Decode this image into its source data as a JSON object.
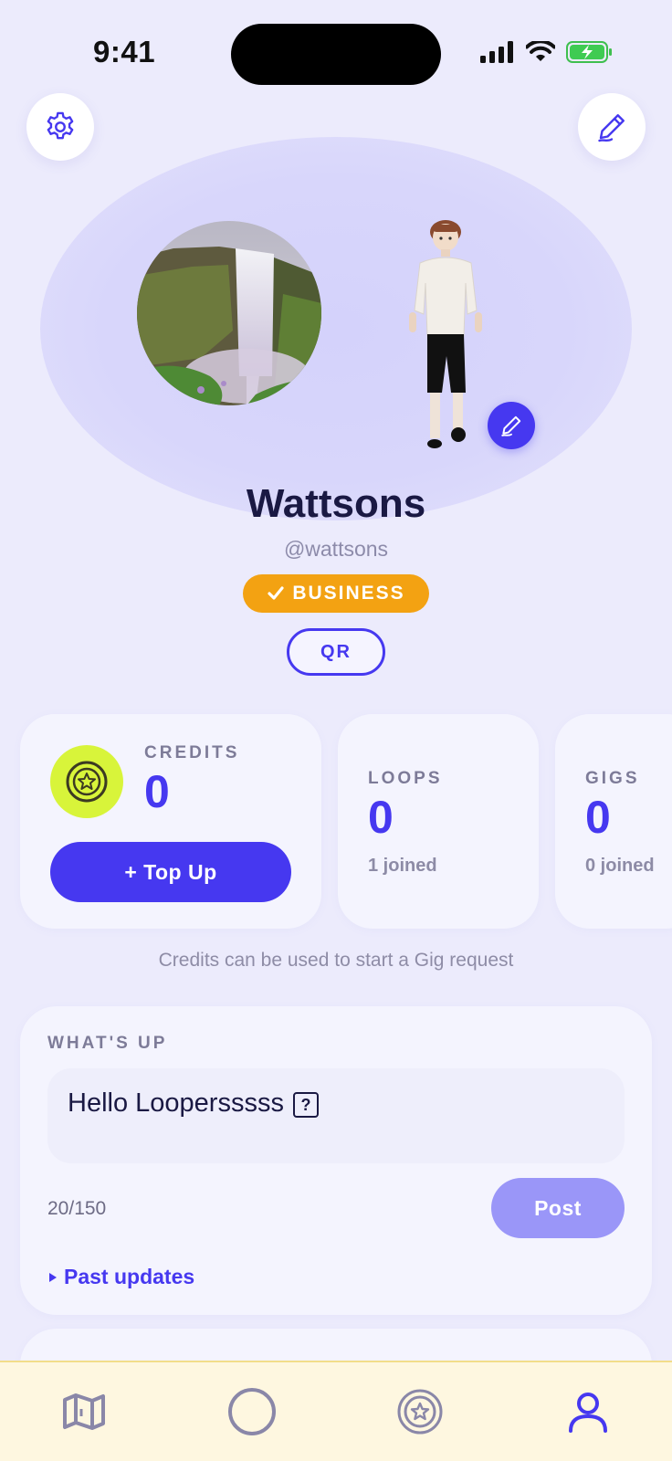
{
  "status_bar": {
    "time": "9:41"
  },
  "profile": {
    "name": "Wattsons",
    "handle": "@wattsons",
    "badge": "BUSINESS",
    "qr_label": "QR"
  },
  "stats": {
    "credits": {
      "label": "CREDITS",
      "value": "0",
      "button": "+ Top Up"
    },
    "loops": {
      "label": "LOOPS",
      "value": "0",
      "sub": "1 joined"
    },
    "gigs": {
      "label": "GIGS",
      "value": "0",
      "sub": "0 joined"
    }
  },
  "credits_note": "Credits can be used to start a Gig request",
  "whats_up": {
    "label": "WHAT'S UP",
    "text": "Hello Loopersssss",
    "char_count": "20/150",
    "post_label": "Post",
    "past_updates": "Past updates"
  },
  "colors": {
    "accent": "#4638F0",
    "badge": "#F3A212",
    "coin": "#D8F43A",
    "nav_bg": "#FEF7E0"
  },
  "icons": {
    "top_left": "gear-icon",
    "top_right": "pencil-icon",
    "nav": [
      "map-icon",
      "circle-icon",
      "coin-star-icon",
      "person-icon"
    ]
  },
  "nav": {
    "active": "person-icon"
  }
}
